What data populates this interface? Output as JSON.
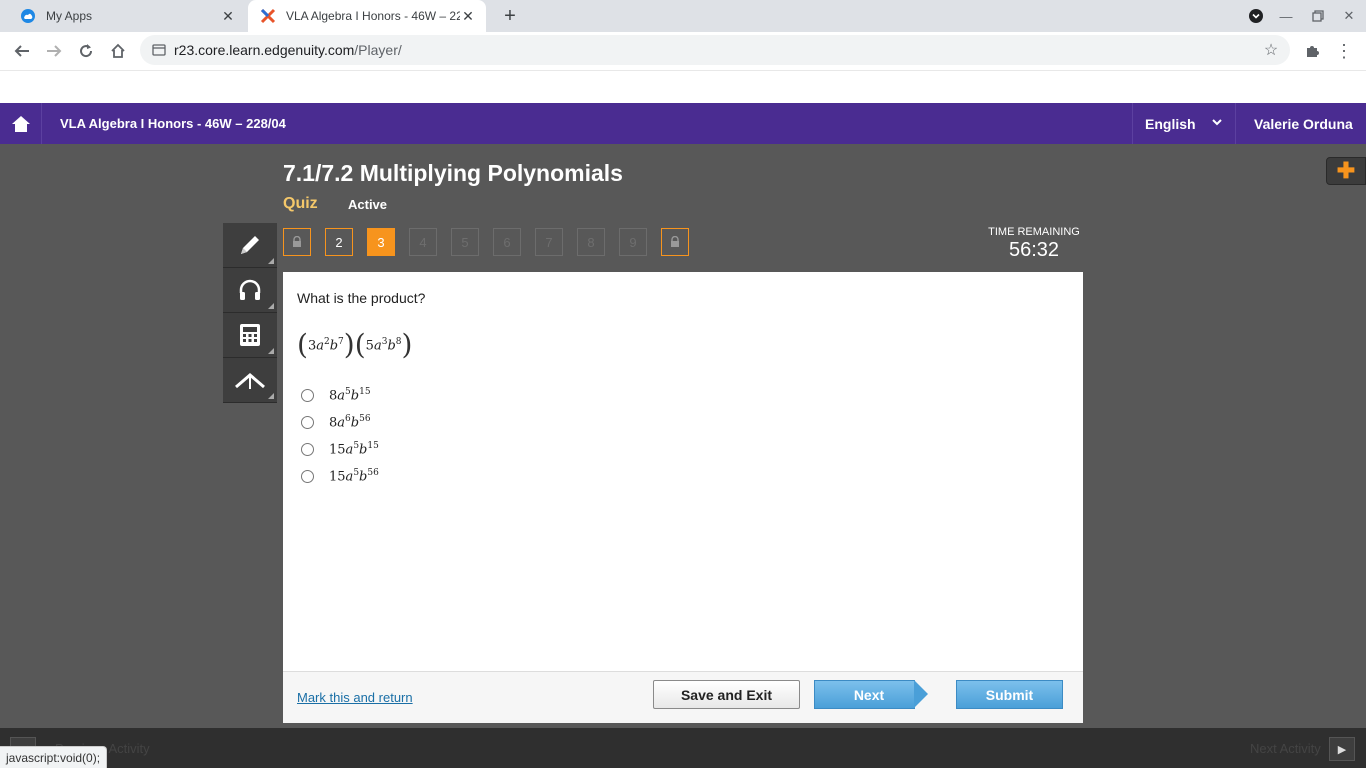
{
  "browser": {
    "tabs": [
      {
        "title": "My Apps",
        "active": false
      },
      {
        "title": "VLA Algebra I Honors - 46W – 228/04",
        "active": true
      }
    ],
    "url_host": "r23.core.learn.edgenuity.com",
    "url_path": "/Player/"
  },
  "header": {
    "course_title": "VLA Algebra I Honors - 46W – 228/04",
    "language": "English",
    "user_name": "Valerie Orduna"
  },
  "lesson": {
    "title": "7.1/7.2 Multiplying Polynomials",
    "activity_type": "Quiz",
    "status": "Active"
  },
  "question_nav": [
    {
      "label": "",
      "state": "locked"
    },
    {
      "label": "2",
      "state": "answered"
    },
    {
      "label": "3",
      "state": "current"
    },
    {
      "label": "4",
      "state": "disabled"
    },
    {
      "label": "5",
      "state": "disabled"
    },
    {
      "label": "6",
      "state": "disabled"
    },
    {
      "label": "7",
      "state": "disabled"
    },
    {
      "label": "8",
      "state": "disabled"
    },
    {
      "label": "9",
      "state": "disabled"
    },
    {
      "label": "",
      "state": "locked"
    }
  ],
  "timer": {
    "label": "TIME REMAINING",
    "value": "56:32"
  },
  "question": {
    "prompt": "What is the product?",
    "expression": {
      "f1": {
        "coef": "3",
        "a_exp": "2",
        "b_exp": "7"
      },
      "f2": {
        "coef": "5",
        "a_exp": "3",
        "b_exp": "8"
      }
    },
    "choices": [
      {
        "coef": "8",
        "a_exp": "5",
        "b_exp": "15"
      },
      {
        "coef": "8",
        "a_exp": "6",
        "b_exp": "56"
      },
      {
        "coef": "15",
        "a_exp": "5",
        "b_exp": "15"
      },
      {
        "coef": "15",
        "a_exp": "5",
        "b_exp": "56"
      }
    ]
  },
  "footer": {
    "mark_link": "Mark this and return",
    "save_exit": "Save and Exit",
    "next": "Next",
    "submit": "Submit"
  },
  "bottom": {
    "previous": "Previous Activity",
    "next": "Next Activity",
    "status_url": "javascript:void(0);"
  },
  "colors": {
    "header": "#4a2c91",
    "accent": "#f7941d",
    "button_blue": "#4a9fd8"
  }
}
